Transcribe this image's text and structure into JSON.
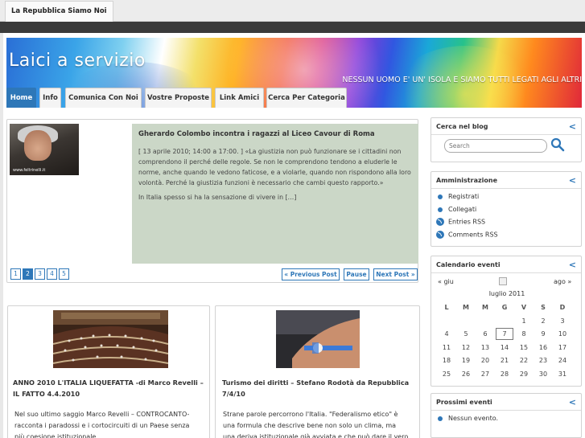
{
  "browser": {
    "site_tab": "La Repubblica Siamo Noi"
  },
  "header": {
    "title": "Laici a servizio",
    "tagline": "NESSUN UOMO E' UN' ISOLA E SIAMO TUTTI LEGATI AGLI ALTRI"
  },
  "nav": {
    "tabs": [
      "Home",
      "Info",
      "Comunica Con Noi",
      "Vostre Proposte",
      "Link Amici",
      "Cerca Per Categoria"
    ],
    "active": "Home"
  },
  "featured": {
    "thumb_caption": "www.feltrinelli.it",
    "title": "Gherardo Colombo incontra i ragazzi al Liceo Cavour di Roma",
    "excerpt": "[ 13 aprile 2010; 14:00 a 17:00. ] «La giustizia non può funzionare se i cittadini non comprendono il perché delle regole. Se non le comprendono tendono a eluderle le norme, anche quando le vedono faticose, e a violarle, quando non rispondono alla loro volontà. Perché la giustizia funzioni è necessario che cambi questo rapporto.»",
    "excerpt_lines": [
      "[ 13 aprile 2010; 14:00 a 17:00. ] «La giustizia non può funzionare se i cittadini non",
      "comprendono il perché delle regole. Se non le comprendono tendono a eluderle le",
      "norme, anche quando le vedono faticose, e a violarle, quando non rispondono alla loro",
      "volontà. Perché la giustizia funzioni è necessario che cambi questo rapporto.»"
    ],
    "more": "In Italia spesso si ha la sensazione di vivere in […]",
    "pages": [
      "1",
      "2",
      "3",
      "4",
      "5"
    ],
    "current_page": "2",
    "prev_label": "« Previous Post",
    "pause_label": "Pause",
    "next_label": "Next Post »"
  },
  "posts": [
    {
      "title": "ANNO 2010 L'ITALIA LIQUEFATTA -di Marco Revelli – IL FATTO 4.4.2010",
      "title_lines": [
        "ANNO 2010 L'ITALIA LIQUEFATTA -di Marco Revelli –",
        "IL FATTO 4.4.2010"
      ],
      "text_lines": [
        "Nel suo ultimo saggio Marco Revelli – CONTROCANTO-",
        "racconta i paradossi e  i cortocircuiti  di un Paese senza",
        "più coesione istituzionale."
      ]
    },
    {
      "title": "Turismo dei diritti – Stefano Rodotà da Repubblica 7/4/10",
      "title_lines": [
        "Turismo dei diritti – Stefano Rodotà da Repubblica",
        "7/4/10"
      ],
      "text_lines": [
        "Strane parole percorrono l'Italia. \"Federalismo etico\" è",
        "una formula che descrive bene non solo un clima, ma",
        "una deriva istituzionale già avviata e che può dare il vero"
      ]
    }
  ],
  "sidebar": {
    "search": {
      "title": "Cerca nel blog",
      "placeholder": "Search"
    },
    "admin": {
      "title": "Amministrazione",
      "items": [
        "Registrati",
        "Collegati",
        "Entries RSS",
        "Comments RSS"
      ]
    },
    "calendar": {
      "title": "Calendario eventi",
      "prev": "« giu",
      "next": "ago »",
      "month": "luglio 2011",
      "weekdays": [
        "L",
        "M",
        "M",
        "G",
        "V",
        "S",
        "D"
      ],
      "weeks": [
        [
          "",
          "",
          "",
          "",
          "1",
          "2",
          "3"
        ],
        [
          "4",
          "5",
          "6",
          "7",
          "8",
          "9",
          "10"
        ],
        [
          "11",
          "12",
          "13",
          "14",
          "15",
          "16",
          "17"
        ],
        [
          "18",
          "19",
          "20",
          "21",
          "22",
          "23",
          "24"
        ],
        [
          "25",
          "26",
          "27",
          "28",
          "29",
          "30",
          "31"
        ]
      ],
      "today": "7"
    },
    "events": {
      "title": "Prossimi eventi",
      "items": [
        "Nessun evento."
      ]
    }
  },
  "colors": {
    "accent": "#2e77b8",
    "featured_box": "#cbd7c7",
    "dark_band": "#3a3a3a"
  }
}
